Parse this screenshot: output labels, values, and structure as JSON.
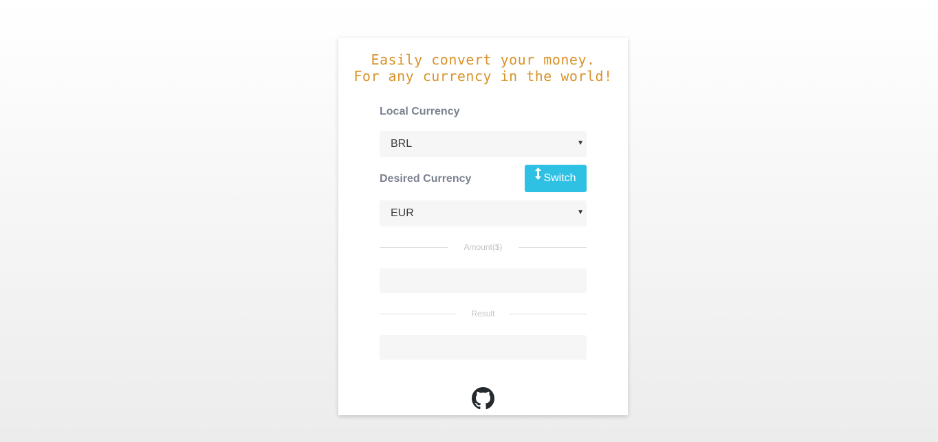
{
  "header": {
    "line1": "Easily convert your money.",
    "line2": "For any currency in the world!"
  },
  "local": {
    "label": "Local Currency",
    "selected": "BRL"
  },
  "desired": {
    "label": "Desired Currency",
    "selected": "EUR"
  },
  "switch_button": {
    "label": "Switch",
    "icon": "vertical-arrows-icon"
  },
  "amount": {
    "divider_label": "Amount($)",
    "value": ""
  },
  "result": {
    "divider_label": "Result",
    "value": ""
  },
  "footer": {
    "icon": "github-icon"
  },
  "colors": {
    "title": "#d9932a",
    "label": "#7b8191",
    "button": "#2ec1e3",
    "field_bg": "#f6f6f6"
  }
}
